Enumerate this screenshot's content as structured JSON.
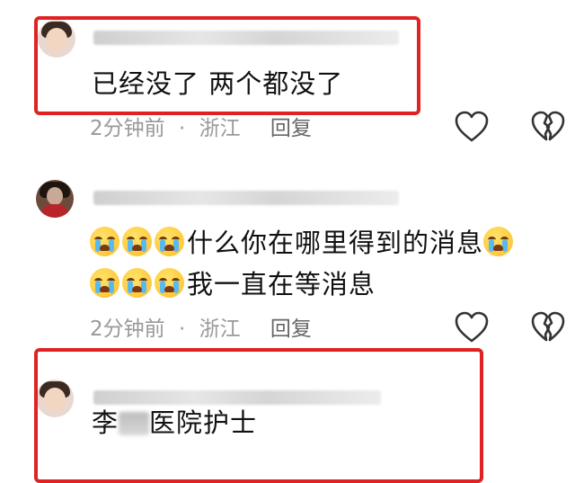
{
  "comments": [
    {
      "username": "",
      "text": "已经没了 两个都没了",
      "time": "2分钟前",
      "separator": "·",
      "location": "浙江",
      "reply_label": "回复",
      "like_icon": "heart-outline-icon",
      "dislike_icon": "broken-heart-icon"
    },
    {
      "username": "",
      "line1": "什么你在哪里得到的消息",
      "line2": "我一直在等消息",
      "emoji": "crying-face-emoji",
      "time": "2分钟前",
      "separator": "·",
      "location": "浙江",
      "reply_label": "回复",
      "like_icon": "heart-outline-icon",
      "dislike_icon": "broken-heart-icon"
    },
    {
      "username": "",
      "text_before": "李",
      "text_after": "医院护士"
    }
  ],
  "highlight_color": "#e02222"
}
